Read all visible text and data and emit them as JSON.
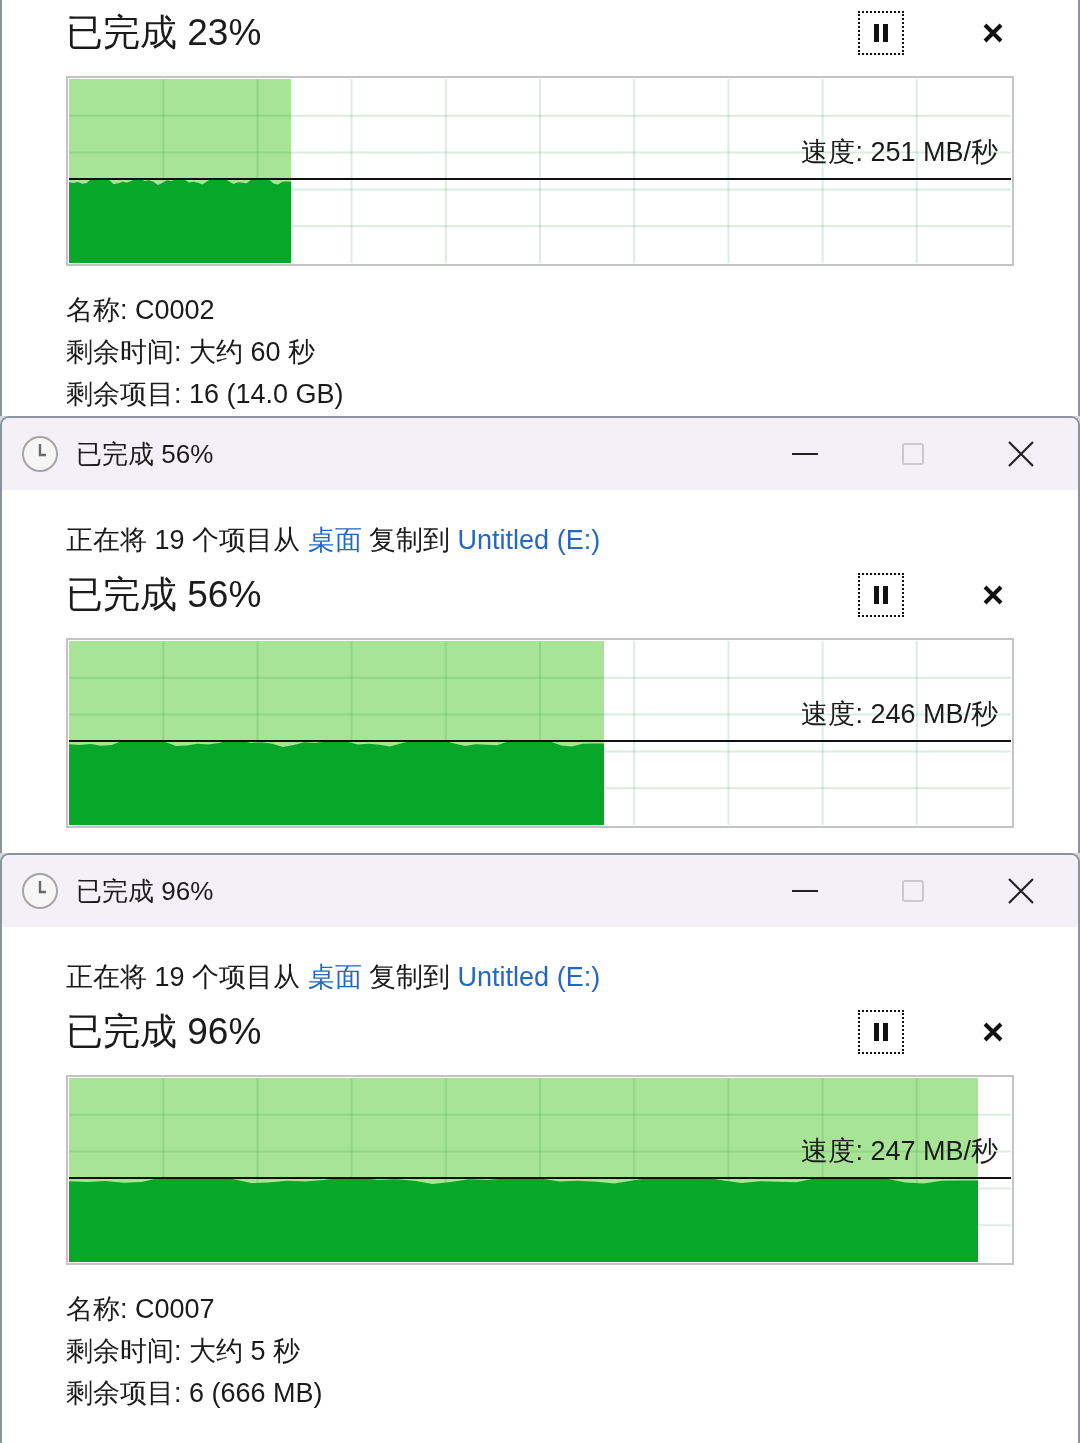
{
  "dialogs": [
    {
      "heading": "已完成 23%",
      "pause_button": {
        "focused": true
      },
      "graph": {
        "level": 0.236,
        "speed": "速度: 251 MB/秒"
      },
      "details": [
        "名称: C0002",
        "剩余时间: 大约 60 秒",
        "剩余项目: 16 (14.0 GB)"
      ]
    },
    {
      "title_bar": {
        "title": "已完成 56%",
        "maximize_disabled": true
      },
      "copy_line": [
        {
          "kind": "text",
          "text": "正在将 19 个项目从"
        },
        {
          "kind": "link",
          "text": "桌面"
        },
        {
          "kind": "text",
          "text": "复制到"
        },
        {
          "kind": "link",
          "text": "Untitled (E:)"
        }
      ],
      "heading": "已完成 56%",
      "pause_button": {
        "focused": true
      },
      "graph": {
        "level": 0.568,
        "speed": "速度: 246 MB/秒"
      }
    },
    {
      "title_bar": {
        "title": "已完成 96%",
        "maximize_disabled": true
      },
      "copy_line": [
        {
          "kind": "text",
          "text": "正在将 19 个项目从"
        },
        {
          "kind": "link",
          "text": "桌面"
        },
        {
          "kind": "text",
          "text": "复制到"
        },
        {
          "kind": "link",
          "text": "Untitled (E:)"
        }
      ],
      "heading": "已完成 96%",
      "pause_button": {
        "focused": true
      },
      "graph": {
        "level": 0.965,
        "speed": "速度: 247 MB/秒"
      },
      "details": [
        "名称: C0007",
        "剩余时间: 大约 5 秒",
        "剩余项目: 6 (666 MB)"
      ]
    }
  ]
}
